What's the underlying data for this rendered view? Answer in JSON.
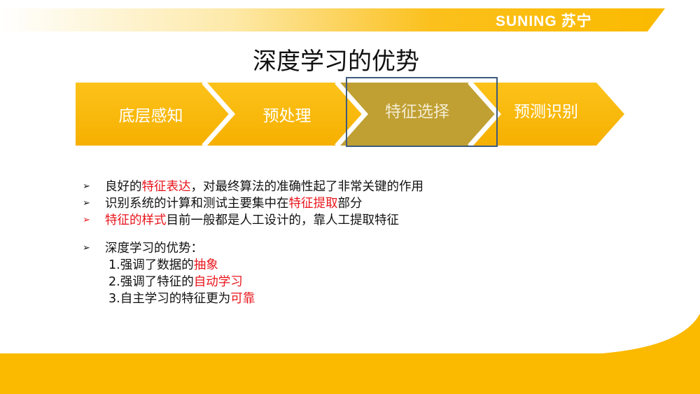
{
  "logo": {
    "text": "SUNING",
    "cn": "苏宁"
  },
  "title": "深度学习的优势",
  "steps": [
    {
      "label": "底层感知"
    },
    {
      "label": "预处理"
    },
    {
      "label": "特征选择"
    },
    {
      "label": "预测识别"
    }
  ],
  "bullets": {
    "marker": "➢",
    "b1": {
      "a": "良好的",
      "b": "特征表达",
      "c": "，对最终算法的准确性起了非常关键的作用"
    },
    "b2": {
      "a": "识别系统的计算和测试主要集中在",
      "b": "特征提取",
      "c": "部分"
    },
    "b3": {
      "a": "特征的样式",
      "b": "目前一般都是人工设计的，靠人工提取特征"
    },
    "b4": {
      "a": "深度学习的优势："
    },
    "s1": {
      "a": "1.强调了数据的",
      "b": "抽象"
    },
    "s2": {
      "a": "2.强调了特征的",
      "b": "自动学习"
    },
    "s3": {
      "a": "3.自主学习的特征更为",
      "b": "可靠"
    }
  },
  "colors": {
    "accent": "#fbbf00",
    "highlight": "#e8151b",
    "select_fill": "#c0a033",
    "select_border": "#3f5a7e"
  }
}
